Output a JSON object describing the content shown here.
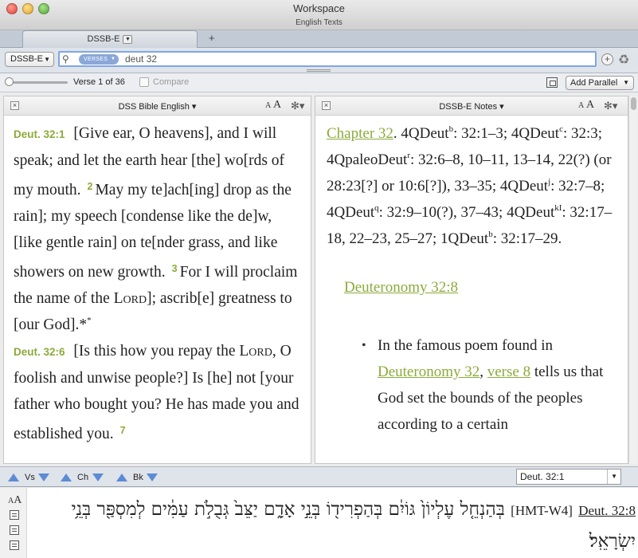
{
  "window": {
    "title": "Workspace",
    "subtitle": "English Texts"
  },
  "tabs": [
    {
      "label": "DSSB-E",
      "dropdown_icon": "triangle-down"
    }
  ],
  "tab_add_glyph": "+",
  "toolbar": {
    "resource": "DSSB-E",
    "search_mode": "VERSES",
    "search_query": "deut 32",
    "add_glyph": "+"
  },
  "verse_bar": {
    "verse_status": "Verse 1 of 36",
    "compare_label": "Compare",
    "add_parallel_label": "Add Parallel"
  },
  "left_pane": {
    "title": "DSS Bible English",
    "font_small": "A",
    "font_large": "A",
    "passage": [
      {
        "type": "ref",
        "text": "Deut. 32:1"
      },
      {
        "type": "text",
        "text": "[Give ear, O heavens], and I will speak; and let the earth hear [the] wo[rds of my mouth."
      },
      {
        "type": "vnum",
        "text": "2"
      },
      {
        "type": "text",
        "text": "May my te]ach[ing] drop as the rain]; my speech [condense like the de]w, [like gentle rain] on te[nder grass, and like showers on new growth."
      },
      {
        "type": "vnum",
        "text": "3"
      },
      {
        "type": "text",
        "text": "For I will proclaim the name of the "
      },
      {
        "type": "sc",
        "text": "Lord"
      },
      {
        "type": "text",
        "text": "]; ascrib[e] greatness to [our God].*"
      },
      {
        "type": "sup",
        "text": "*"
      },
      {
        "type": "ref",
        "text": "Deut. 32:6",
        "block": true
      },
      {
        "type": "text",
        "text": "[Is this how you repay the "
      },
      {
        "type": "sc",
        "text": "Lord"
      },
      {
        "type": "text",
        "text": ", O foolish and unwise people?] Is [he] not [your father who bought you? He has made you and established you."
      },
      {
        "type": "vnum",
        "text": "7"
      }
    ]
  },
  "right_pane": {
    "title": "DSSB-E Notes",
    "font_small": "A",
    "font_large": "A",
    "chapter_link": "Chapter 32",
    "note_parts": [
      {
        "t": ". 4QDeut"
      },
      {
        "sup": "b"
      },
      {
        "t": ": 32:1–3; 4QDeut"
      },
      {
        "sup": "c"
      },
      {
        "t": ": 32:3; 4QpaleoDeut"
      },
      {
        "sup": "r"
      },
      {
        "t": ": 32:6–8, 10–11, 13–14, 22(?) (or 28:23[?] or 10:6[?]), 33–35; 4QDeut"
      },
      {
        "sup": "j"
      },
      {
        "t": ": 32:7–8; 4QDeut"
      },
      {
        "sup": "q"
      },
      {
        "t": ": 32:9–10(?), 37–43; 4QDeut"
      },
      {
        "sup": "kI"
      },
      {
        "t": ": 32:17–18, 22–23, 25–27; 1QDeut"
      },
      {
        "sup": "b"
      },
      {
        "t": ": 32:17–29."
      }
    ],
    "section_heading": "Deuteronomy 32:8",
    "bullet": {
      "before": "In the famous poem found in ",
      "link1": "Deuteronomy 32",
      "comma": ", ",
      "link2": "verse 8",
      "after": " tells us that God set the bounds of the peoples according to a certain"
    }
  },
  "nav": {
    "verse_label": "Vs",
    "chapter_label": "Ch",
    "book_label": "Bk",
    "reference": "Deut. 32:1"
  },
  "hebrew": {
    "font_small": "A",
    "font_large": "A",
    "reference": "Deut. 32:8",
    "tag": "[HMT-W4]",
    "text": "בְּהַנְחֵ֤ל עֶלְיוֹן֙ גּוֹיִ֔ם בְּהַפְרִיד֖וֹ בְּנֵ֣י אָדָ֑ם יַצֵּב֙ גְּבֻלֹ֣ת עַמִּ֔ים לְמִסְפַּ֖ר בְּנֵ֥י יִשְׂרָאֵֽל׃"
  },
  "colors": {
    "verse_ref": "#8bab3a",
    "link": "#8bab3a",
    "nav_arrow": "#5d8bd4"
  }
}
